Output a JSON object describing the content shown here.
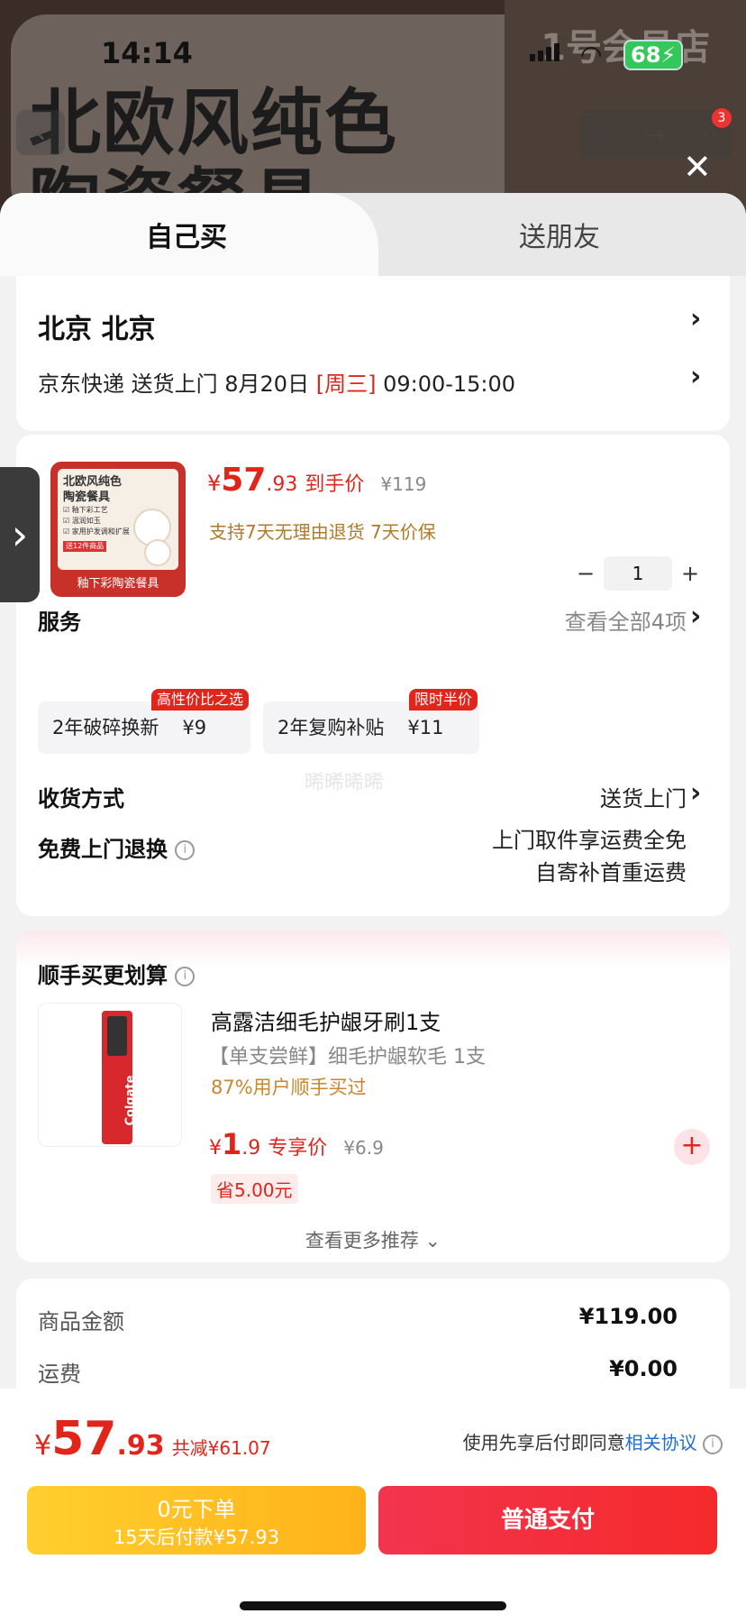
{
  "background": {
    "title_line1": "北欧风纯色",
    "title_line2": "陶瓷餐具",
    "brand": "1号会员店"
  },
  "status_bar": {
    "time": "14:14",
    "battery": "68"
  },
  "nav": {
    "badge": "3"
  },
  "tabs": [
    {
      "label": "自己买",
      "active": true
    },
    {
      "label": "送朋友",
      "active": false
    }
  ],
  "address": {
    "region": "北京  北京",
    "delivery_prefix": "京东快递 送货上门 8月20日 ",
    "delivery_day": "[周三]",
    "delivery_time": " 09:00-15:00"
  },
  "product": {
    "image": {
      "title1": "北欧风纯色",
      "title2": "陶瓷餐具",
      "features": [
        "☑ 釉下彩工艺",
        "☑ 温润如玉",
        "☑ 家用护发调和扩展"
      ],
      "badge": "送12件商品",
      "bottom": "釉下彩陶瓷餐具"
    },
    "price_currency": "¥",
    "price_int": "57",
    "price_dec": ".93",
    "price_tag": "到手价",
    "original_price": "¥119",
    "policy": "支持7天无理由退货  7天价保",
    "quantity": "1"
  },
  "services": {
    "title": "服务",
    "view_all": "查看全部4项",
    "items": [
      {
        "name": "2年破碎换新",
        "fee": "¥9",
        "badge": "高性价比之选"
      },
      {
        "name": "2年复购补贴",
        "fee": "¥11",
        "badge": "限时半价"
      }
    ]
  },
  "receive": {
    "title": "收货方式",
    "value": "送货上门"
  },
  "free_return": {
    "title": "免费上门退换",
    "line1": "上门取件享运费全免",
    "line2": "自寄补首重运费"
  },
  "watermark": "晞晞晞晞",
  "upsell": {
    "title": "顺手买更划算",
    "item": {
      "name": "高露洁细毛护龈牙刷1支",
      "desc": "【单支尝鲜】细毛护龈软毛 1支",
      "bought": "87%用户顺手买过",
      "price_currency": "¥",
      "price_int": "1",
      "price_dec": ".9",
      "price_tag": "专享价",
      "original_price": "¥6.9",
      "save": "省5.00元",
      "brand_on_image": "Colgate"
    },
    "more": "查看更多推荐"
  },
  "summary": [
    {
      "label": "商品金额",
      "value": "¥119.00"
    },
    {
      "label": "运费",
      "value": "¥0.00"
    }
  ],
  "footer": {
    "currency": "¥",
    "total_int": "57",
    "total_dec": ".93",
    "discount": "共减¥61.07",
    "agree_text": "使用先享后付即同意",
    "agree_link": "相关协议",
    "zero_line1": "0元下单",
    "zero_line2": "15天后付款¥57.93",
    "pay_label": "普通支付"
  },
  "colors": {
    "accent": "#e1251b",
    "gold": "#ffc21f",
    "link": "#1a6fd6"
  }
}
